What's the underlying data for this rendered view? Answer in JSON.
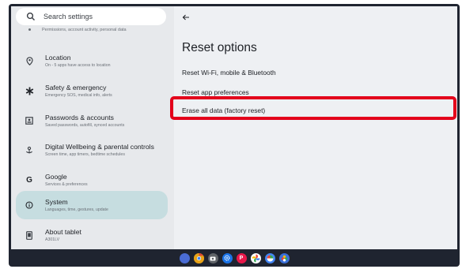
{
  "search": {
    "placeholder": "Search settings"
  },
  "sidebar": {
    "top_subtitle": "Permissions, account activity, personal data",
    "items": [
      {
        "title": "Location",
        "subtitle": "On - 5 apps have access to location",
        "icon": "location-pin-icon"
      },
      {
        "title": "Safety & emergency",
        "subtitle": "Emergency SOS, medical info, alerts",
        "icon": "asterisk-icon"
      },
      {
        "title": "Passwords & accounts",
        "subtitle": "Saved passwords, autofill, synced accounts",
        "icon": "account-box-icon"
      },
      {
        "title": "Digital Wellbeing & parental controls",
        "subtitle": "Screen time, app timers, bedtime schedules",
        "icon": "wellbeing-icon"
      },
      {
        "title": "Google",
        "subtitle": "Services & preferences",
        "icon": "google-g-icon"
      },
      {
        "title": "System",
        "subtitle": "Languages, time, gestures, update",
        "icon": "info-icon",
        "active": true
      },
      {
        "title": "About tablet",
        "subtitle": "A301LV",
        "icon": "tablet-icon"
      }
    ]
  },
  "main": {
    "title": "Reset options",
    "options": [
      "Reset Wi-Fi, mobile & Bluetooth",
      "Reset app preferences",
      "Erase all data (factory reset)"
    ]
  },
  "taskbar": {
    "apps": [
      {
        "name": "assistant-icon",
        "color": "#4a6cd4"
      },
      {
        "name": "chrome-icon",
        "color": "#e8a317"
      },
      {
        "name": "camera-icon",
        "color": "#5f6368"
      },
      {
        "name": "settings-icon",
        "color": "#1a73e8"
      },
      {
        "name": "app-p-icon",
        "color": "#e8174a"
      },
      {
        "name": "photos-icon",
        "color": "#34a853"
      },
      {
        "name": "app-pinwheel-icon",
        "color": "#4285f4"
      },
      {
        "name": "app-flower-icon",
        "color": "#3a6fd8"
      }
    ]
  },
  "colors": {
    "highlight": "#e3001b",
    "active_item": "#c6dde0"
  }
}
